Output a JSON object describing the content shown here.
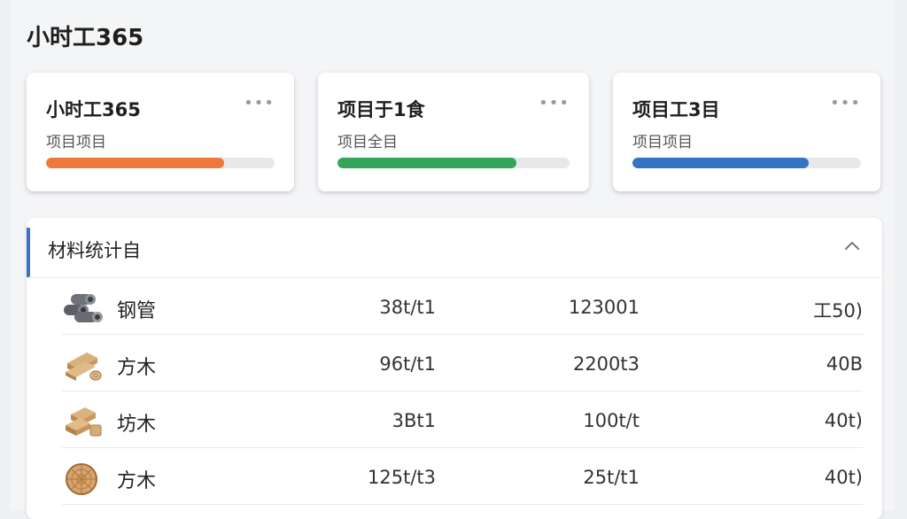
{
  "app": {
    "title": "小时工365"
  },
  "cards": [
    {
      "title": "小时工365",
      "subtitle": "项目项目",
      "more": "•••",
      "progress": 0.78,
      "color": "#ec7a3d"
    },
    {
      "title": "项目于1食",
      "subtitle": "项目全目",
      "more": "•••",
      "progress": 0.77,
      "color": "#33a55a"
    },
    {
      "title": "项目工3目",
      "subtitle": "项目项目",
      "more": "•••",
      "progress": 0.77,
      "color": "#3574c5"
    }
  ],
  "panel": {
    "title": "材料统计自",
    "accent_color": "#3a73c4",
    "rows": [
      {
        "icon": "steel-pipe-icon",
        "name": "钢管",
        "c1": "38t/t1",
        "c2": "123001",
        "c3": "工50)"
      },
      {
        "icon": "lumber-planks-icon",
        "name": "方木",
        "c1": "96t/t1",
        "c2": "2200t3",
        "c3": "40B"
      },
      {
        "icon": "lumber-stack-icon",
        "name": "坊木",
        "c1": "3Bt1",
        "c2": "100t/t",
        "c3": "40t)"
      },
      {
        "icon": "wood-log-end-icon",
        "name": "方木",
        "c1": "125t/t3",
        "c2": "25t/t1",
        "c3": "40t)"
      }
    ]
  }
}
